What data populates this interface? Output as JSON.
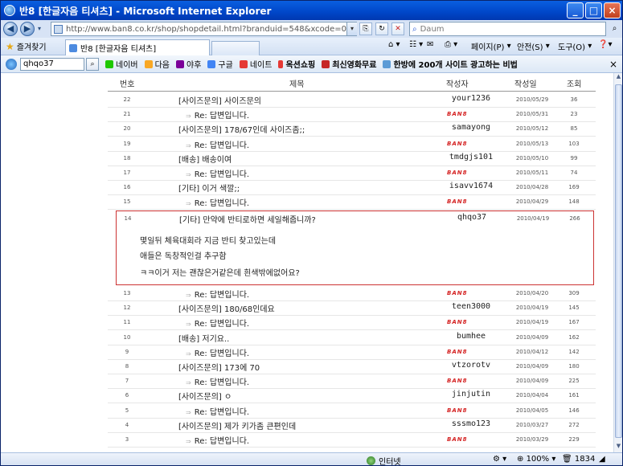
{
  "window": {
    "title": "반8 [한글자음 티셔츠] - Microsoft Internet Explorer"
  },
  "address": {
    "url": "http://www.ban8.co.kr/shop/shopdetail.html?branduid=548&xcode=001&mcode=",
    "search_placeholder": "Daum"
  },
  "favorites": {
    "label": "즐겨찾기",
    "tab_title": "반8 [한글자음 티셔츠]",
    "commands": [
      "페이지(P)",
      "안전(S)",
      "도구(O)"
    ]
  },
  "linkbar": {
    "search_value": "qhqo37",
    "links": [
      "네이버",
      "다음",
      "야후",
      "구글",
      "네이트",
      "옥션쇼핑",
      "최신영화무료",
      "한방에 200개 사이트 광고하는 비법"
    ]
  },
  "board": {
    "headers": {
      "no": "번호",
      "title": "제목",
      "author": "작성자",
      "date": "작성일",
      "views": "조회"
    },
    "logo_text": "BAN8",
    "rows_top": [
      {
        "no": "22",
        "title": "[사이즈문의] 사이즈문의",
        "author": "your1236",
        "date": "2010/05/29",
        "views": "36",
        "re": false
      },
      {
        "no": "21",
        "title": "Re: 답변입니다.",
        "author": "",
        "date": "2010/05/31",
        "views": "23",
        "re": true
      },
      {
        "no": "20",
        "title": "[사이즈문의] 178/67인데 사이즈좀;;",
        "author": "samayong",
        "date": "2010/05/12",
        "views": "85",
        "re": false
      },
      {
        "no": "19",
        "title": "Re: 답변입니다.",
        "author": "",
        "date": "2010/05/13",
        "views": "103",
        "re": true
      },
      {
        "no": "18",
        "title": "[배송] 배송이여",
        "author": "tmdgjs101",
        "date": "2010/05/10",
        "views": "99",
        "re": false
      },
      {
        "no": "17",
        "title": "Re: 답변입니다.",
        "author": "",
        "date": "2010/05/11",
        "views": "74",
        "re": true
      },
      {
        "no": "16",
        "title": "[기타] 이거 색깔;;",
        "author": "isavv1674",
        "date": "2010/04/28",
        "views": "169",
        "re": false
      },
      {
        "no": "15",
        "title": "Re: 답변입니다.",
        "author": "",
        "date": "2010/04/29",
        "views": "148",
        "re": true
      }
    ],
    "selected": {
      "no": "14",
      "title": "[기타] 만약에 반티로하면 세일해줍니까?",
      "author": "qhqo37",
      "date": "2010/04/19",
      "views": "266",
      "body": [
        "몇일뒤 체육대회라 지금 반티 찾고있는데",
        "애들은 독창적인걸 추구함",
        "ㅋㅋ이거 저는 괜찮은거같은데 흰색밖에없어요?"
      ]
    },
    "rows_bottom": [
      {
        "no": "13",
        "title": "Re: 답변입니다.",
        "author": "",
        "date": "2010/04/20",
        "views": "309",
        "re": true
      },
      {
        "no": "12",
        "title": "[사이즈문의] 180/68인데요",
        "author": "teen3000",
        "date": "2010/04/19",
        "views": "145",
        "re": false
      },
      {
        "no": "11",
        "title": "Re: 답변입니다.",
        "author": "",
        "date": "2010/04/19",
        "views": "167",
        "re": true
      },
      {
        "no": "10",
        "title": "[배송] 저기요..",
        "author": "bumhee",
        "date": "2010/04/09",
        "views": "162",
        "re": false
      },
      {
        "no": "9",
        "title": "Re: 답변입니다.",
        "author": "",
        "date": "2010/04/12",
        "views": "142",
        "re": true
      },
      {
        "no": "8",
        "title": "[사이즈문의] 173에 70",
        "author": "vtzorotv",
        "date": "2010/04/09",
        "views": "180",
        "re": false
      },
      {
        "no": "7",
        "title": "Re: 답변입니다.",
        "author": "",
        "date": "2010/04/09",
        "views": "225",
        "re": true
      },
      {
        "no": "6",
        "title": "[사이즈문의] ㅇ",
        "author": "jinjutin",
        "date": "2010/04/04",
        "views": "161",
        "re": false
      },
      {
        "no": "5",
        "title": "Re: 답변입니다.",
        "author": "",
        "date": "2010/04/05",
        "views": "146",
        "re": true
      },
      {
        "no": "4",
        "title": "[사이즈문의] 제가 키가좀 큰편인데",
        "author": "sssmo123",
        "date": "2010/03/27",
        "views": "272",
        "re": false
      },
      {
        "no": "3",
        "title": "Re: 답변입니다.",
        "author": "",
        "date": "2010/03/29",
        "views": "229",
        "re": true
      }
    ]
  },
  "status": {
    "zone": "인터넷",
    "zoom": "100%",
    "count": "1834"
  }
}
